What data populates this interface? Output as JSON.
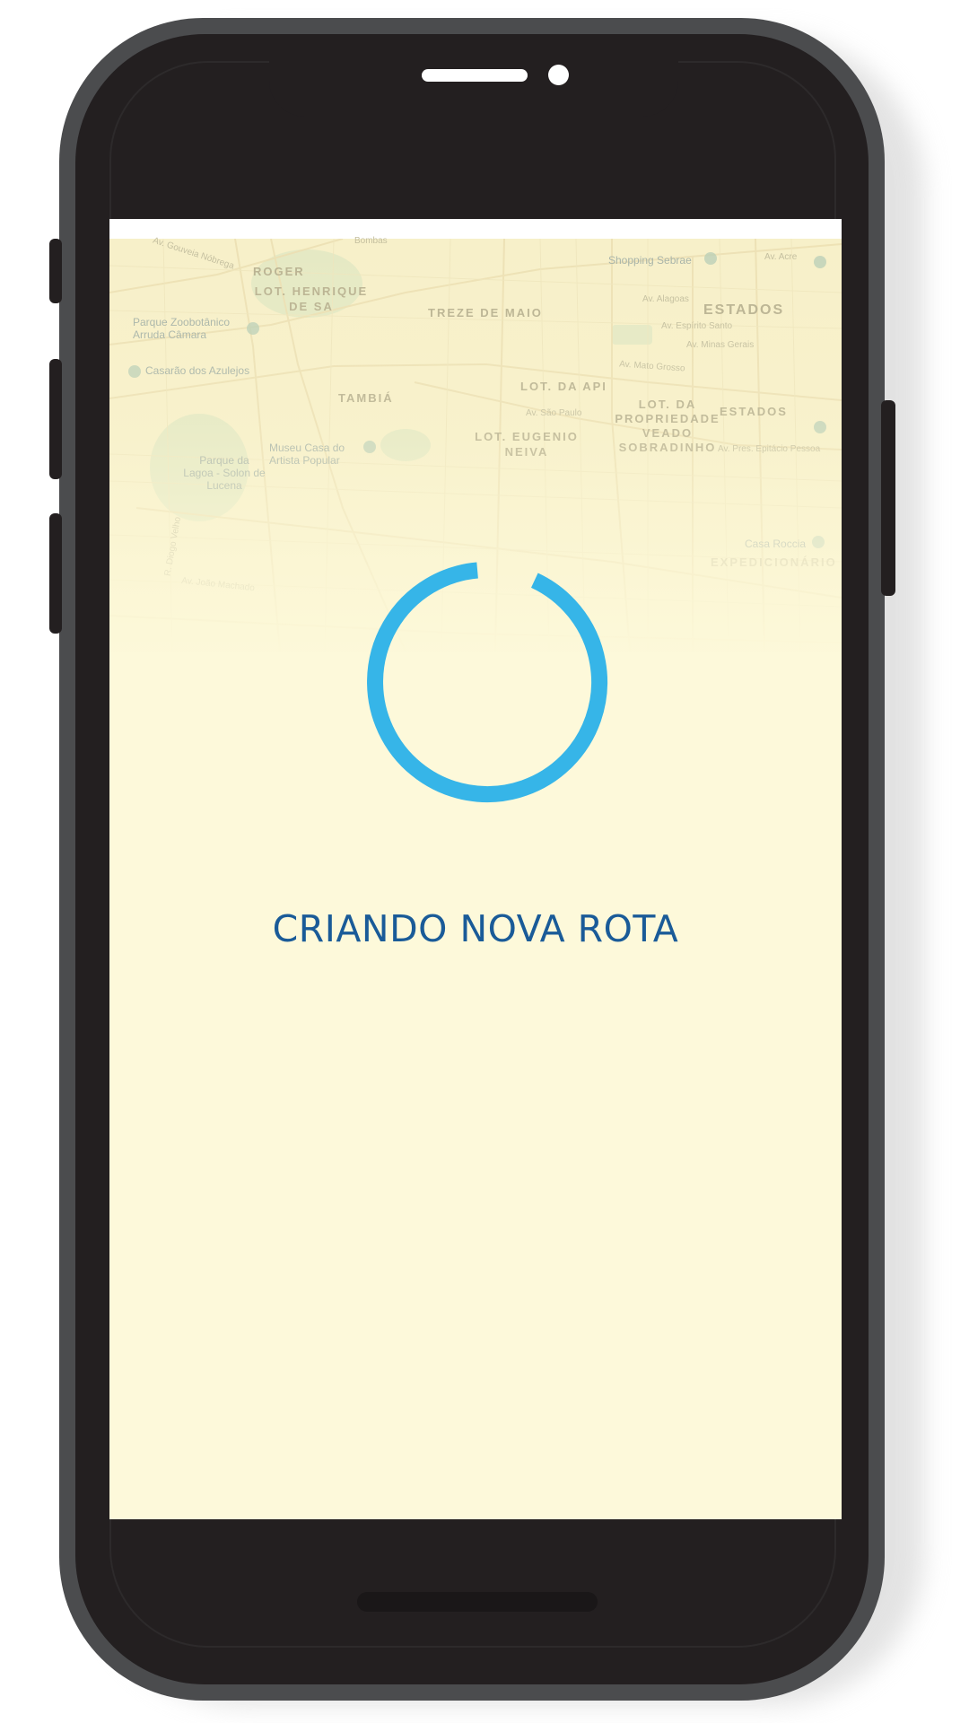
{
  "loading": {
    "message": "CRIANDO NOVA ROTA",
    "spinner_color": "#36b5e8",
    "text_color": "#1a5b98"
  },
  "screen": {
    "background": "#fdf9da"
  },
  "map": {
    "districts": [
      "ROGER",
      "LOT. HENRIQUE DE SA",
      "TREZE DE MAIO",
      "ESTADOS",
      "TAMBIÁ",
      "LOT. DA API",
      "LOT. DA PROPRIEDADE VEADO SOBRADINHO",
      "ESTADOS",
      "LOT. EUGENIO NEIVA",
      "EXPEDICIONÁRIO"
    ],
    "pois": [
      "Parque Zoobotânico Arruda Câmara",
      "Casarão dos Azulejos",
      "Museu Casa do Artista Popular",
      "Parque da Lagoa - Solon de Lucena",
      "Shopping Sebrae",
      "Casa Roccia"
    ],
    "streets": [
      "Av. Gouveia Nóbrega",
      "Bombas",
      "Av. Acre",
      "Av. Alagoas",
      "Av. Espírito Santo",
      "Av. Minas Gerais",
      "Av. Mato Grosso",
      "Av. São Paulo",
      "Av. Pres. Epitácio Pessoa",
      "Av. João Machado",
      "R. Diogo Velho"
    ],
    "icons": [
      "place-pin-icon"
    ]
  }
}
